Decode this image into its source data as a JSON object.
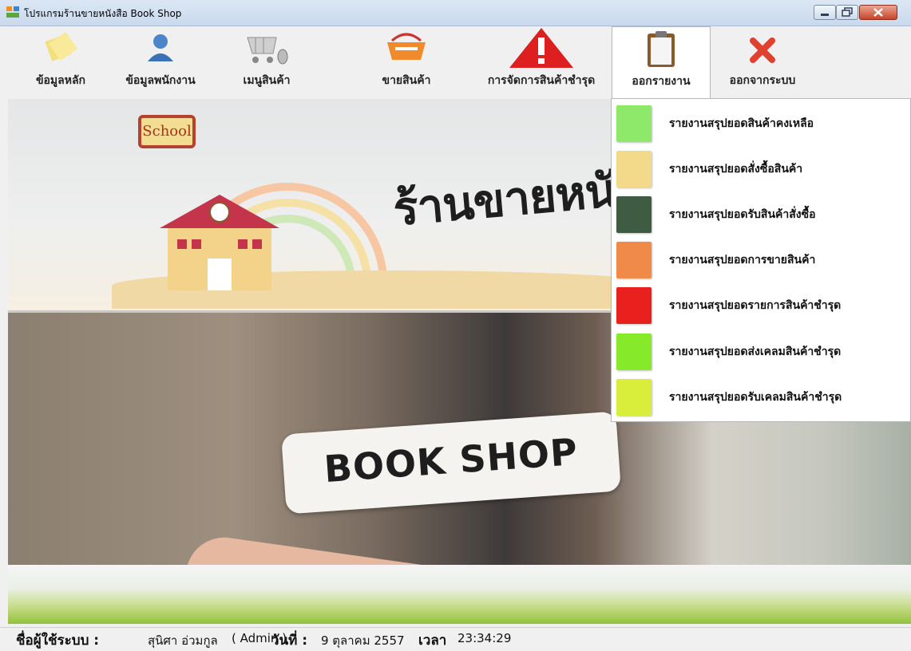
{
  "window": {
    "title": "โปรแกรมร้านขายหนังสือ Book Shop"
  },
  "menu": [
    {
      "name": "master-data",
      "label": "ข้อมูลหลัก",
      "icon": "notes-icon"
    },
    {
      "name": "employee-data",
      "label": "ข้อมูลพนักงาน",
      "icon": "user-icon"
    },
    {
      "name": "product-menu",
      "label": "เมนูสินค้า",
      "icon": "shopping-cart-icon"
    },
    {
      "name": "sell-product",
      "label": "ขายสินค้า",
      "icon": "basket-icon"
    },
    {
      "name": "damaged-products",
      "label": "การจัดการสินค้าชำรุด",
      "icon": "warning-icon"
    },
    {
      "name": "reports",
      "label": "ออกรายงาน",
      "icon": "clipboard-icon"
    },
    {
      "name": "logout",
      "label": "ออกจากระบบ",
      "icon": "close-x-icon"
    }
  ],
  "banner": {
    "title": "ร้านขายหนังสือ",
    "sign": "School",
    "bookshop": "BOOK SHOP"
  },
  "report_menu": [
    {
      "label": "รายงานสรุปยอดสินค้าคงเหลือ",
      "color": "#8ee86a"
    },
    {
      "label": "รายงานสรุปยอดสั่งซื้อสินค้า",
      "color": "#f3d98a"
    },
    {
      "label": "รายงานสรุปยอดรับสินค้าสั่งซื้อ",
      "color": "#3f5c43"
    },
    {
      "label": "รายงานสรุปยอดการขายสินค้า",
      "color": "#f08a48"
    },
    {
      "label": "รายงานสรุปยอดรายการสินค้าชำรุด",
      "color": "#e8201e"
    },
    {
      "label": "รายงานสรุปยอดส่งเคลมสินค้าชำรุด",
      "color": "#86ea2a"
    },
    {
      "label": "รายงานสรุปยอดรับเคลมสินค้าชำรุด",
      "color": "#d8ee3a"
    }
  ],
  "status": {
    "user_label": "ชื่อผู้ใช้ระบบ :",
    "user_name": "สุนิศา อ่วมกูล",
    "role": "( Admin )",
    "date_label": "วันที่ :",
    "date": "9 ตุลาคม 2557",
    "time_label": "เวลา",
    "time": "23:34:29"
  }
}
